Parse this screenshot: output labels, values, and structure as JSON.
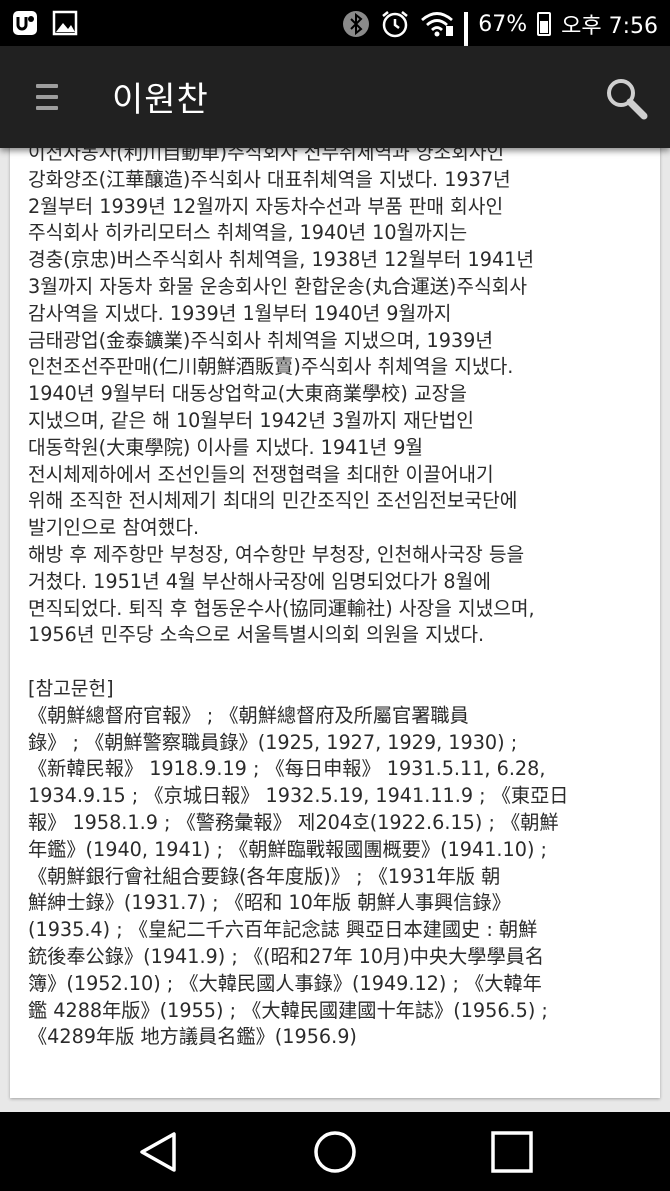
{
  "status_bar": {
    "battery_text": "67%",
    "time": "오후 7:56",
    "battery_level": 0.67,
    "icons": [
      "app-notification-icon",
      "image-icon",
      "bluetooth-icon",
      "alarm-icon",
      "wifi-icon",
      "signal-icon",
      "battery-icon"
    ]
  },
  "app_bar": {
    "title": "이원찬",
    "icons": [
      "menu-icon",
      "search-icon"
    ]
  },
  "article": {
    "lines": [
      "이천자동차(利川自動車)주식회사 전무취체역과 양조회사인",
      "강화양조(江華釀造)주식회사 대표취체역을 지냈다. 1937년",
      "2월부터 1939년 12월까지 자동차수선과 부품 판매 회사인",
      "주식회사 히카리모터스 취체역을, 1940년 10월까지는",
      "경충(京忠)버스주식회사 취체역을, 1938년 12월부터 1941년",
      "3월까지 자동차 화물 운송회사인 환합운송(丸合運送)주식회사",
      "감사역을 지냈다. 1939년 1월부터 1940년 9월까지",
      "금태광업(金泰鑛業)주식회사 취체역을 지냈으며, 1939년",
      "인천조선주판매(仁川朝鮮酒販賣)주식회사 취체역을 지냈다.",
      "1940년 9월부터 대동상업학교(大東商業學校) 교장을",
      "지냈으며, 같은 해 10월부터 1942년 3월까지 재단법인",
      "대동학원(大東學院) 이사를 지냈다. 1941년 9월",
      "전시체제하에서 조선인들의 전쟁협력을 최대한 이끌어내기",
      "위해 조직한 전시체제기 최대의 민간조직인 조선임전보국단에",
      "발기인으로 참여했다.",
      "해방 후 제주항만 부청장, 여수항만 부청장, 인천해사국장 등을",
      "거쳤다. 1951년 4월 부산해사국장에 임명되었다가 8월에",
      "면직되었다. 퇴직 후 협동운수사(協同運輸社) 사장을 지냈으며,",
      "1956년 민주당 소속으로 서울특별시의회 의원을 지냈다."
    ],
    "references_heading": "[참고문헌]",
    "references_lines": [
      "《朝鮮總督府官報》 ; 《朝鮮總督府及所屬官署職員",
      "錄》 ; 《朝鮮警察職員錄》(1925, 1927, 1929, 1930) ;",
      "《新韓民報》 1918.9.19 ; 《每日申報》 1931.5.11, 6.28,",
      "1934.9.15 ; 《京城日報》 1932.5.19, 1941.11.9 ; 《東亞日",
      "報》 1958.1.9 ; 《警務彙報》 제204호(1922.6.15) ; 《朝鮮",
      "年鑑》(1940, 1941) ; 《朝鮮臨戰報國團概要》(1941.10) ;",
      "《朝鮮銀行會社組合要錄(各年度版)》 ; 《1931年版 朝",
      "鮮紳士錄》(1931.7) ; 《昭和 10年版 朝鮮人事興信錄》",
      "(1935.4) ; 《皇紀二千六百年記念誌 興亞日本建國史 : 朝鮮",
      "銃後奉公錄》(1941.9) ; 《(昭和27年 10月)中央大學學員名",
      "簿》(1952.10) ; 《大韓民國人事錄》(1949.12) ; 《大韓年",
      "鑑 4288年版》(1955) ; 《大韓民國建國十年誌》(1956.5) ;",
      "《4289年版 地方議員名鑑》(1956.9)"
    ]
  },
  "nav_bar": {
    "icons": [
      "back-icon",
      "home-icon",
      "recents-icon"
    ]
  }
}
